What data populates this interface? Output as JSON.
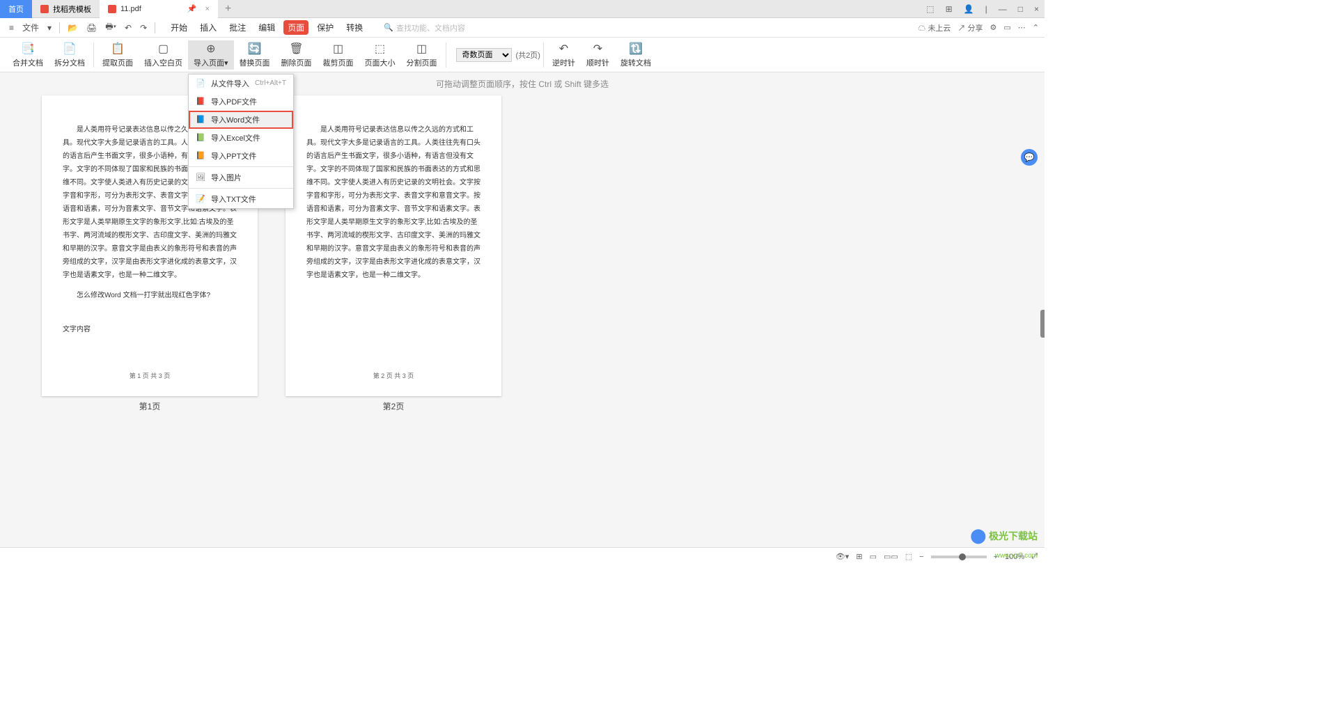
{
  "tabs": {
    "home": "首页",
    "template": "找稻壳模板",
    "file": "11.pdf"
  },
  "menubar": {
    "file": "文件",
    "tabs": [
      "开始",
      "插入",
      "批注",
      "编辑",
      "页面",
      "保护",
      "转换"
    ],
    "active": "页面",
    "search_placeholder": "查找功能、文档内容",
    "notcloud": "未上云",
    "share": "分享"
  },
  "toolbar": {
    "items": [
      "合并文档",
      "拆分文档",
      "提取页面",
      "插入空白页",
      "导入页面",
      "替换页面",
      "删除页面",
      "裁剪页面",
      "页面大小",
      "分割页面"
    ],
    "select_label": "奇数页面",
    "count": "(共2页)",
    "rotate": [
      "逆时针",
      "顺时针",
      "旋转文档"
    ]
  },
  "dropdown": {
    "items": [
      {
        "label": "从文件导入",
        "shortcut": "Ctrl+Alt+T"
      },
      {
        "label": "导入PDF文件"
      },
      {
        "label": "导入Word文件",
        "hl": true
      },
      {
        "label": "导入Excel文件"
      },
      {
        "label": "导入PPT文件"
      },
      {
        "label": "导入图片"
      },
      {
        "label": "导入TXT文件"
      }
    ]
  },
  "workspace": {
    "hint": "可拖动调整页面顺序，按住 Ctrl 或 Shift 键多选",
    "page1": {
      "body": "是人类用符号记录表达信息以传之久远的方式和工具。现代文字大多是记录语言的工具。人类往往先有口头的语言后产生书面文字，很多小语种，有语言但没有文字。文字的不同体现了国家和民族的书面表达的方式和思维不同。文字使人类进入有历史记录的文明社会。文字按字音和字形，可分为表形文字、表音文字和意音文字。按语音和语素，可分为音素文字、音节文字和语素文字。表形文字是人类早期原生文字的象形文字,比如:古埃及的圣书字、两河流域的楔形文字、古印度文字、美洲的玛雅文和早期的汉字。意音文字是由表义的象形符号和表音的声旁组成的文字，汉字是由表形文字进化成的表意文字，汉字也是语素文字，也是一种二维文字。",
      "q": "怎么修改Word 文档一打字就出现红色字体?",
      "t": "文字内容",
      "footer": "第 1 页 共 3 页",
      "label": "第1页"
    },
    "page2": {
      "body": "是人类用符号记录表达信息以传之久远的方式和工具。现代文字大多是记录语言的工具。人类往往先有口头的语言后产生书面文字，很多小语种，有语言但没有文字。文字的不同体现了国家和民族的书面表达的方式和思维不同。文字使人类进入有历史记录的文明社会。文字按字音和字形，可分为表形文字、表音文字和意音文字。按语音和语素，可分为音素文字、音节文字和语素文字。表形文字是人类早期原生文字的象形文字,比如:古埃及的圣书字、两河流域的楔形文字、古印度文字、美洲的玛雅文和早期的汉字。意音文字是由表义的象形符号和表音的声旁组成的文字，汉字是由表形文字进化成的表意文字，汉字也是语素文字，也是一种二维文字。",
      "footer": "第 2 页 共 3 页",
      "label": "第2页"
    }
  },
  "statusbar": {
    "zoom": "100%"
  },
  "watermark": {
    "brand": "极光下载站",
    "url": "www.xz7.com"
  }
}
